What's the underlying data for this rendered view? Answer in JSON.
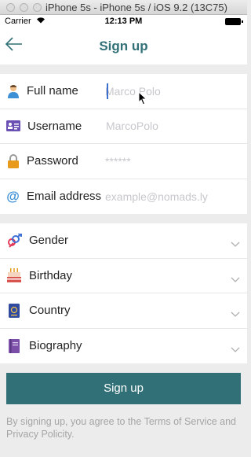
{
  "window": {
    "title": "iPhone 5s - iPhone 5s / iOS 9.2 (13C75)"
  },
  "status": {
    "carrier": "Carrier",
    "time": "12:13 PM"
  },
  "nav": {
    "title": "Sign up"
  },
  "fields": [
    {
      "label": "Full name",
      "placeholder": "Marco Polo",
      "icon": "person-icon"
    },
    {
      "label": "Username",
      "placeholder": "MarcoPolo",
      "icon": "id-card-icon"
    },
    {
      "label": "Password",
      "placeholder": "******",
      "icon": "lock-icon"
    },
    {
      "label": "Email address",
      "placeholder": "example@nomads.ly",
      "icon": "at-icon"
    }
  ],
  "selects": [
    {
      "label": "Gender",
      "icon": "gender-icon"
    },
    {
      "label": "Birthday",
      "icon": "cake-icon"
    },
    {
      "label": "Country",
      "icon": "passport-icon"
    },
    {
      "label": "Biography",
      "icon": "book-icon"
    }
  ],
  "submit_label": "Sign up",
  "terms": "By signing up, you agree to the Terms of Service and Privacy Policity.",
  "colors": {
    "accent": "#317077",
    "background": "#ececec"
  }
}
